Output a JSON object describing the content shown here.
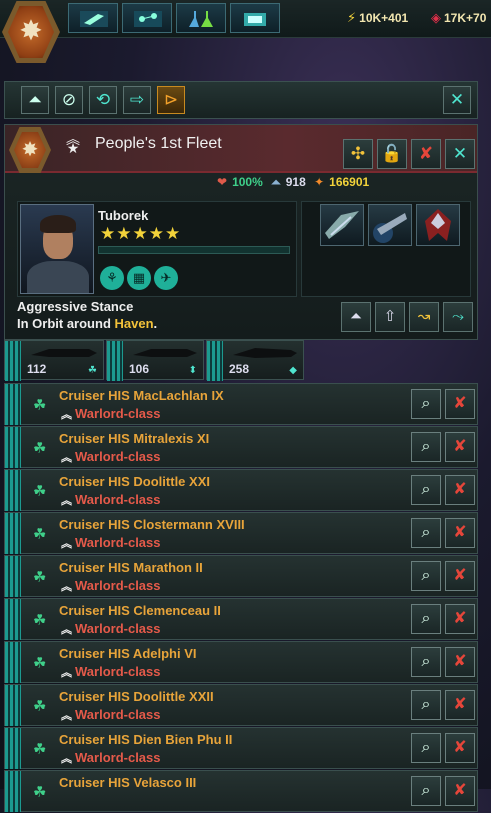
{
  "topbar": {
    "resources": [
      {
        "icon": "energy-icon",
        "glyph": "⚡",
        "value": "10K+401",
        "color": "#f2d23a"
      },
      {
        "icon": "influence-icon",
        "glyph": "◈",
        "value": "17K+70",
        "color": "#e0304a"
      }
    ],
    "buttons": [
      "ship-designer-icon",
      "galaxy-map-icon",
      "research-icon",
      "market-icon"
    ]
  },
  "commands": {
    "buttons": [
      "fleet-stance-icon",
      "stop-icon",
      "return-icon",
      "move-icon",
      "merge-fleet-icon"
    ],
    "close_label": "✕"
  },
  "fleet": {
    "name": "People's 1st Fleet",
    "rank_glyph": "⌃⌃★",
    "health": "100%",
    "naval_capacity": "918",
    "fleet_power": "166901",
    "header_buttons": [
      "split-fleet-icon",
      "lock-icon",
      "disband-icon",
      "close-icon"
    ],
    "admiral": {
      "name": "Tuborek",
      "stars": "★★★★★",
      "traits": [
        "⚘",
        "▦",
        "✈"
      ]
    },
    "stance": "Aggressive Stance",
    "orbit_prefix": "In Orbit around ",
    "orbit_planet": "Haven",
    "orbit_suffix": ".",
    "stance_buttons": [
      "upgrade-icon",
      "promote-icon",
      "evade-icon",
      "redirect-icon"
    ]
  },
  "composition": [
    {
      "count": "112",
      "glyph": "☘"
    },
    {
      "count": "106",
      "glyph": "⬍"
    },
    {
      "count": "258",
      "glyph": "◆"
    }
  ],
  "ships": [
    {
      "name": "Cruiser HIS MacLachlan IX",
      "class": "Warlord-class"
    },
    {
      "name": "Cruiser HIS Mitralexis XI",
      "class": "Warlord-class"
    },
    {
      "name": "Cruiser HIS Doolittle XXI",
      "class": "Warlord-class"
    },
    {
      "name": "Cruiser HIS Clostermann XVIII",
      "class": "Warlord-class"
    },
    {
      "name": "Cruiser HIS Marathon II",
      "class": "Warlord-class"
    },
    {
      "name": "Cruiser HIS Clemenceau II",
      "class": "Warlord-class"
    },
    {
      "name": "Cruiser HIS Adelphi VI",
      "class": "Warlord-class"
    },
    {
      "name": "Cruiser HIS Doolittle XXII",
      "class": "Warlord-class"
    },
    {
      "name": "Cruiser HIS Dien Bien Phu II",
      "class": "Warlord-class"
    },
    {
      "name": "Cruiser HIS Velasco III",
      "class": ""
    }
  ]
}
